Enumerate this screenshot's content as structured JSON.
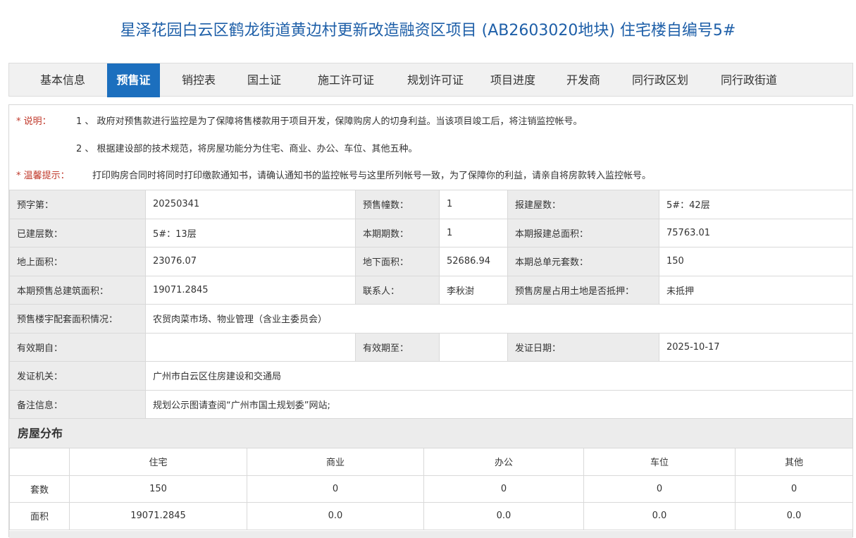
{
  "page": {
    "title": "星泽花园白云区鹤龙街道黄边村更新改造融资区项目 (AB2603020地块) 住宅楼自编号5#"
  },
  "tabs": [
    {
      "label": "基本信息",
      "active": false
    },
    {
      "label": "预售证",
      "active": true
    },
    {
      "label": "销控表",
      "active": false
    },
    {
      "label": "国土证",
      "active": false
    },
    {
      "label": "施工许可证",
      "active": false
    },
    {
      "label": "规划许可证",
      "active": false
    },
    {
      "label": "项目进度",
      "active": false
    },
    {
      "label": "开发商",
      "active": false
    },
    {
      "label": "同行政区划",
      "active": false
    },
    {
      "label": "同行政街道",
      "active": false
    }
  ],
  "notes": {
    "note_label": "* 说明：",
    "note1": "1 、 政府对预售款进行监控是为了保障将售楼款用于项目开发，保障购房人的切身利益。当该项目竣工后，将注销监控帐号。",
    "note2": "2 、 根据建设部的技术规范，将房屋功能分为住宅、商业、办公、车位、其他五种。",
    "tip_label": "* 温馨提示：",
    "tip": "打印购房合同时将同时打印缴款通知书，请确认通知书的监控帐号与这里所列帐号一致，为了保障你的利益，请亲自将房款转入监控帐号。"
  },
  "info": {
    "r1": {
      "l1": "预字第：",
      "v1": "20250341",
      "l2": "预售幢数：",
      "v2": "1",
      "l3": "报建屋数：",
      "v3": "5#：42层"
    },
    "r2": {
      "l1": "已建层数：",
      "v1": "5#：13层",
      "l2": "本期期数：",
      "v2": "1",
      "l3": "本期报建总面积：",
      "v3": "75763.01"
    },
    "r3": {
      "l1": "地上面积：",
      "v1": "23076.07",
      "l2": "地下面积：",
      "v2": "52686.94",
      "l3": "本期总单元套数：",
      "v3": "150"
    },
    "r4": {
      "l1": "本期预售总建筑面积：",
      "v1": "19071.2845",
      "l2": "联系人：",
      "v2": "李秋澍",
      "l3": "预售房屋占用土地是否抵押：",
      "v3": "未抵押"
    },
    "r5": {
      "l1": "预售楼宇配套面积情况：",
      "v1": "农贸肉菜市场、物业管理（含业主委员会）"
    },
    "r6": {
      "l1": "有效期自：",
      "v1": "",
      "l2": "有效期至：",
      "v2": "",
      "l3": "发证日期：",
      "v3": "2025-10-17"
    },
    "r7": {
      "l1": "发证机关：",
      "v1": "广州市白云区住房建设和交通局"
    },
    "r8": {
      "l1": "备注信息：",
      "v1": "规划公示图请查阅“广州市国土规划委”网站;"
    }
  },
  "distribution": {
    "title": "房屋分布",
    "headers": [
      "",
      "住宅",
      "商业",
      "办公",
      "车位",
      "其他"
    ],
    "rows": [
      {
        "label": "套数",
        "values": [
          "150",
          "0",
          "0",
          "0",
          "0"
        ]
      },
      {
        "label": "面积",
        "values": [
          "19071.2845",
          "0.0",
          "0.0",
          "0.0",
          "0.0"
        ]
      }
    ]
  }
}
